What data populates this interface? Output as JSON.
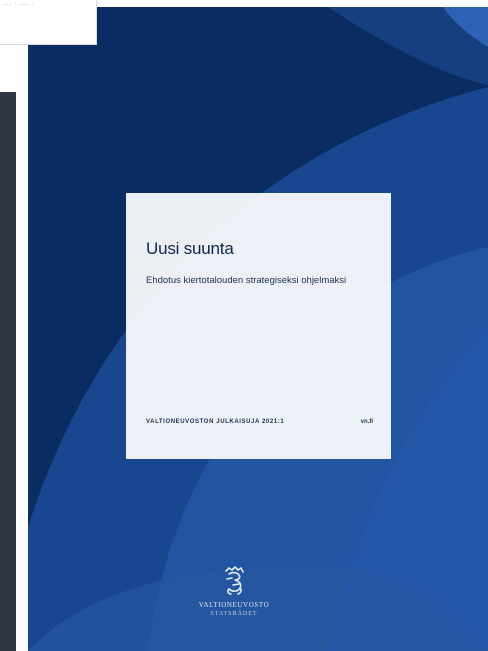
{
  "top_card": {
    "text": "....  ·  ....  ·"
  },
  "publication": {
    "title": "Uusi suunta",
    "subtitle": "Ehdotus kiertotalouden strategiseksi ohjelmaksi",
    "series": "VALTIONEUVOSTON JULKAISUJA  2021:1",
    "site": "vn.fi"
  },
  "publisher": {
    "name_fi": "VALTIONEUVOSTO",
    "name_sv": "STATSRÅDET",
    "emblem_icon": "finnish-lion-crest-icon"
  },
  "colors": {
    "cover_dark": "#0b2b63",
    "cover_mid": "#1d4f9a",
    "cover_light": "#2f64b8",
    "left_strip": "#2f3844"
  }
}
